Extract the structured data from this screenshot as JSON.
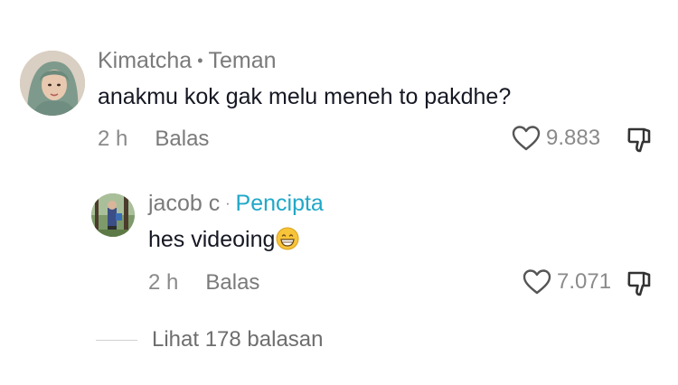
{
  "comment": {
    "author": "Kimatcha",
    "relation": "Teman",
    "separator": "•",
    "text": "anakmu kok gak melu meneh to pakdhe?",
    "time": "2 h",
    "reply_label": "Balas",
    "likes": "9.883"
  },
  "reply": {
    "author": "jacob c",
    "separator": "·",
    "badge": "Pencipta",
    "text": "hes videoing",
    "emoji": "grinning-face-emoji",
    "time": "2 h",
    "reply_label": "Balas",
    "likes": "7.071"
  },
  "view_replies": {
    "label": "Lihat 178 balasan"
  },
  "colors": {
    "text_primary": "#161823",
    "text_secondary": "#7a7a7a",
    "creator_badge": "#20a8c8"
  }
}
